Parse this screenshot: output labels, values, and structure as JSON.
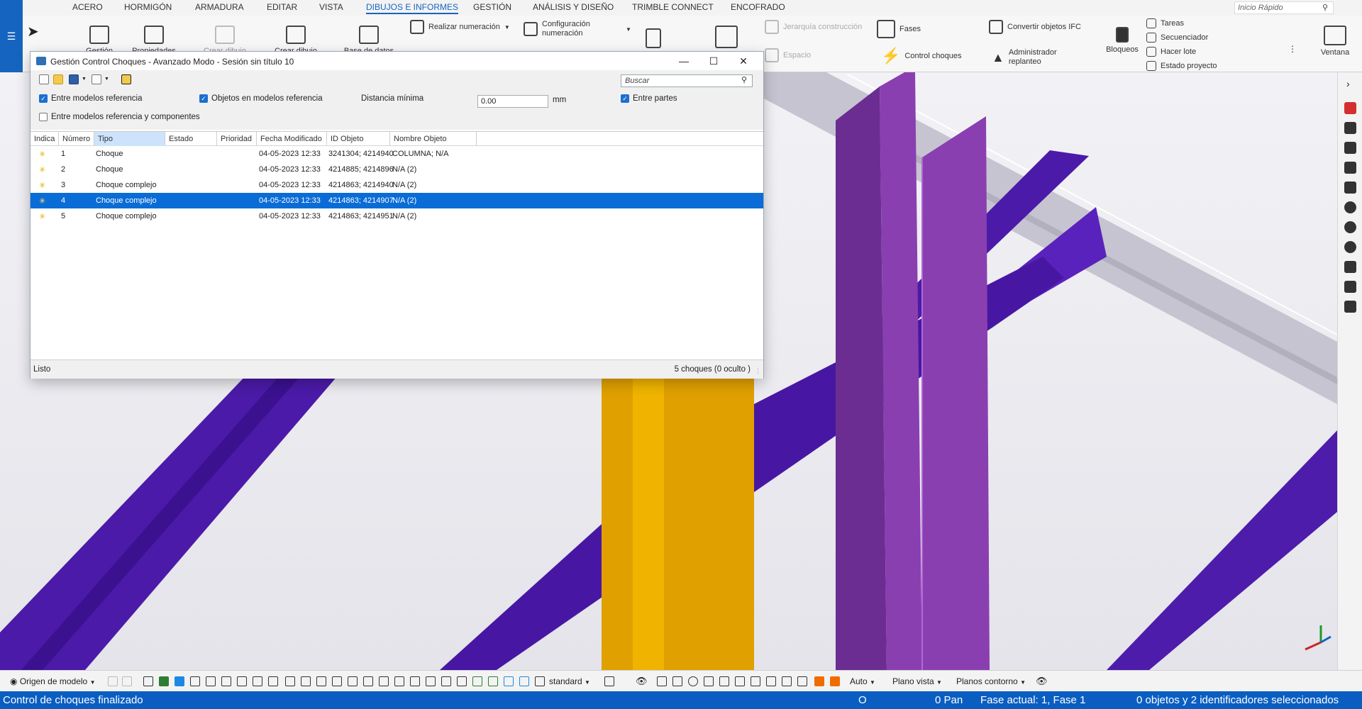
{
  "ribbon_tabs": [
    {
      "label": "ACERO",
      "active": false
    },
    {
      "label": "HORMIGÓN",
      "active": false
    },
    {
      "label": "ARMADURA",
      "active": false
    },
    {
      "label": "EDITAR",
      "active": false
    },
    {
      "label": "VISTA",
      "active": false
    },
    {
      "label": "DIBUJOS E INFORMES",
      "active": true
    },
    {
      "label": "GESTIÓN",
      "active": false
    },
    {
      "label": "ANÁLISIS Y DISEÑO",
      "active": false
    },
    {
      "label": "TRIMBLE CONNECT",
      "active": false
    },
    {
      "label": "ENCOFRADO",
      "active": false
    }
  ],
  "quick_search": {
    "placeholder": "Inicio Rápido"
  },
  "ribbon": {
    "gestion": "Gestión",
    "propiedades": "Propiedades",
    "crear_dibujo": "Crear dibujo",
    "crear_dibujo_2": "Crear dibujo",
    "base_datos": "Base de datos",
    "realizar_numeracion": "Realizar numeración",
    "configuracion_numeracion": "Configuración numeración",
    "jerarquia_construccion": "Jerarquía construcción",
    "espacio": "Espacio",
    "fases": "Fases",
    "control_choques": "Control choques",
    "convertir_ifc": "Convertir objetos IFC",
    "administrador_replanteo": "Administrador replanteo",
    "bloqueos": "Bloqueos",
    "tareas": "Tareas",
    "secuenciador": "Secuenciador",
    "hacer_lote": "Hacer lote",
    "estado_proyecto": "Estado proyecto",
    "ventana": "Ventana"
  },
  "dialog": {
    "title": "Gestión Control Choques - Avanzado Modo - Sesión sin título 10",
    "search_placeholder": "Buscar",
    "options": {
      "entre_modelos_referencia": {
        "label": "Entre modelos referencia",
        "checked": true
      },
      "objetos_modelos_referencia": {
        "label": "Objetos en modelos referencia",
        "checked": true
      },
      "distancia_minima_label": "Distancia mínima",
      "distancia_minima_value": "0.00",
      "distancia_unit": "mm",
      "entre_partes": {
        "label": "Entre partes",
        "checked": true
      },
      "entre_modelos_componentes": {
        "label": "Entre modelos referencia y componentes",
        "checked": false
      }
    },
    "columns": [
      "Indica",
      "Número",
      "Tipo",
      "Estado",
      "Prioridad",
      "Fecha Modificado",
      "ID Objeto",
      "Nombre Objeto"
    ],
    "rows": [
      {
        "numero": "1",
        "tipo": "Choque",
        "estado": "",
        "prioridad": "",
        "fecha": "04-05-2023 12:33",
        "id": "3241304; 4214940",
        "nombre": "COLUMNA; N/A",
        "selected": false
      },
      {
        "numero": "2",
        "tipo": "Choque",
        "estado": "",
        "prioridad": "",
        "fecha": "04-05-2023 12:33",
        "id": "4214885; 4214896",
        "nombre": "N/A (2)",
        "selected": false
      },
      {
        "numero": "3",
        "tipo": "Choque complejo",
        "estado": "",
        "prioridad": "",
        "fecha": "04-05-2023 12:33",
        "id": "4214863; 4214940",
        "nombre": "N/A (2)",
        "selected": false
      },
      {
        "numero": "4",
        "tipo": "Choque complejo",
        "estado": "",
        "prioridad": "",
        "fecha": "04-05-2023 12:33",
        "id": "4214863; 4214907",
        "nombre": "N/A (2)",
        "selected": true
      },
      {
        "numero": "5",
        "tipo": "Choque complejo",
        "estado": "",
        "prioridad": "",
        "fecha": "04-05-2023 12:33",
        "id": "4214863; 4214951",
        "nombre": "N/A (2)",
        "selected": false
      }
    ],
    "status_left": "Listo",
    "status_right": "5 choques (0 oculto )"
  },
  "bottom_toolbar": {
    "origin": "Origen de modelo",
    "filter": "standard",
    "auto": "Auto",
    "plano_vista": "Plano vista",
    "planos_contorno": "Planos contorno"
  },
  "statusbar": {
    "message": "Control de choques finalizado",
    "o": "O",
    "pan": "0  Pan",
    "fase": "Fase actual: 1, Fase 1",
    "selection": "0 objetos y 2 identificadores seleccionados"
  },
  "colors": {
    "accent": "#1565c0",
    "status_bar": "#0a5ec1",
    "selected_row": "#0a6cd6",
    "beam_purple": "#4b1aa8",
    "column_violet": "#8a3fb0",
    "column_gold": "#e0a000"
  }
}
